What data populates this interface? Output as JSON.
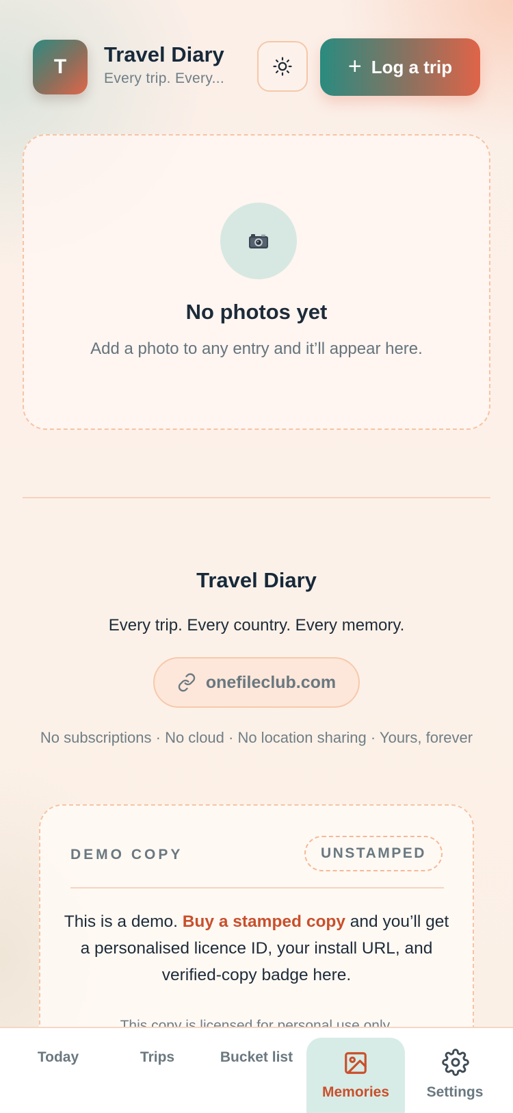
{
  "header": {
    "logo_letter": "T",
    "title": "Travel Diary",
    "subtitle": "Every trip. Every...",
    "theme_icon": "sun-icon",
    "log_button": {
      "icon": "plus-icon",
      "label": "Log a trip"
    }
  },
  "empty_state": {
    "icon": "camera-icon",
    "title": "No photos yet",
    "text": "Add a photo to any entry and it’ll appear here."
  },
  "footer": {
    "title": "Travel Diary",
    "tagline": "Every trip. Every country. Every memory.",
    "link_icon": "link-icon",
    "link_label": "onefileclub.com",
    "note": "No subscriptions · No cloud · No location sharing · Yours, forever"
  },
  "demo": {
    "label": "DEMO COPY",
    "badge": "UNSTAMPED",
    "text_before": "This is a demo. ",
    "link": "Buy a stamped copy",
    "text_after": " and you’ll get a personalised licence ID, your install URL, and verified-copy badge here.",
    "license": "This copy is licensed for personal use only."
  },
  "nav": {
    "items": [
      {
        "label": "Today"
      },
      {
        "label": "Trips"
      },
      {
        "label": "Bucket list"
      },
      {
        "label": "Memories",
        "icon": "image-icon",
        "active": true
      },
      {
        "label": "Settings",
        "icon": "gear-icon"
      }
    ]
  },
  "colors": {
    "accent": "#c8502c",
    "teal": "#2a8b80",
    "ink": "#17293a",
    "muted": "#6a7880"
  }
}
